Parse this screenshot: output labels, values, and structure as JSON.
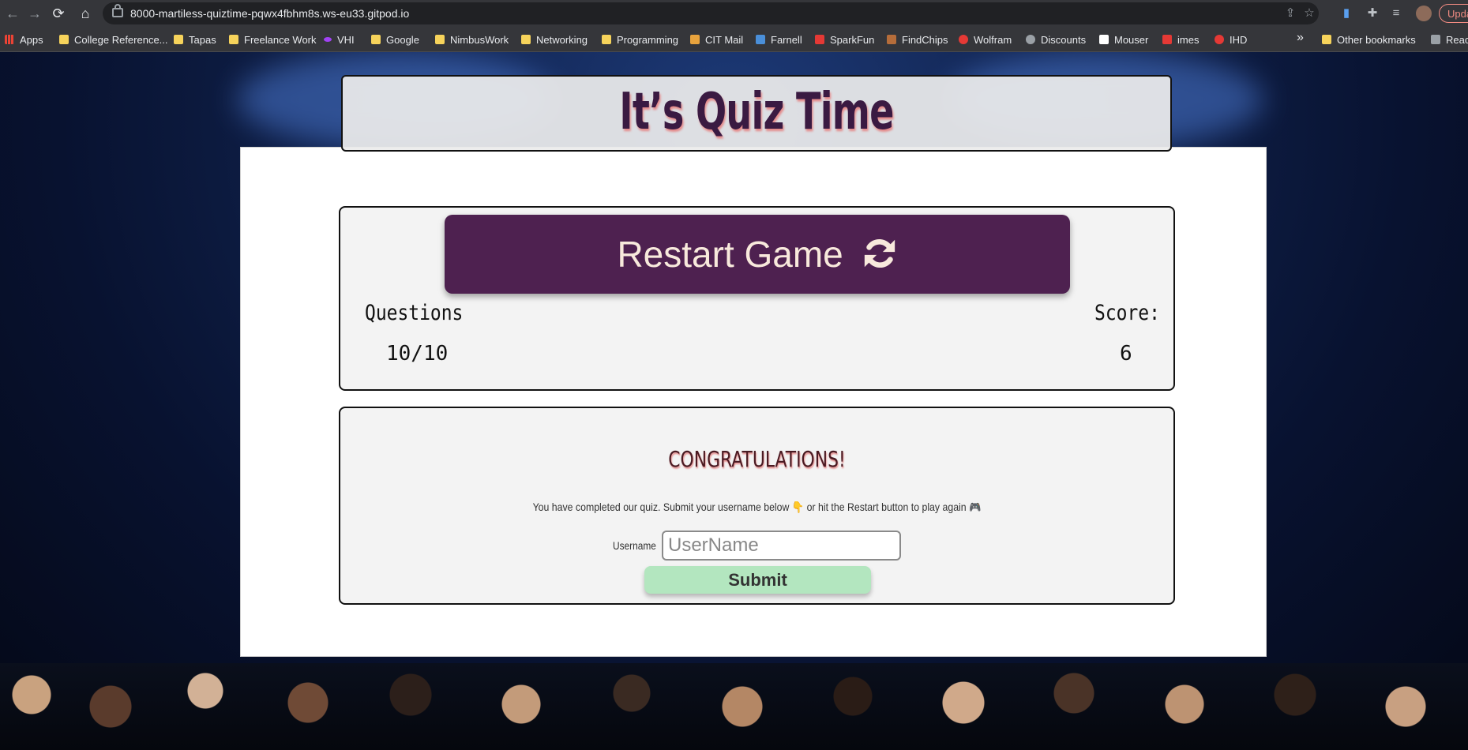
{
  "browser": {
    "url": "8000-martiless-quiztime-pqwx4fbhm8s.ws-eu33.gitpod.io",
    "update_label": "Update"
  },
  "bookmarks": [
    {
      "label": "Apps",
      "icon": "apps-grid-icon"
    },
    {
      "label": "College Reference...",
      "icon": "folder-icon"
    },
    {
      "label": "Tapas",
      "icon": "folder-icon"
    },
    {
      "label": "Freelance Work",
      "icon": "folder-icon"
    },
    {
      "label": "VHI",
      "icon": "vhi-logo-icon"
    },
    {
      "label": "Google",
      "icon": "folder-icon"
    },
    {
      "label": "NimbusWork",
      "icon": "folder-icon"
    },
    {
      "label": "Networking",
      "icon": "folder-icon"
    },
    {
      "label": "Programming",
      "icon": "folder-icon"
    },
    {
      "label": "CIT Mail",
      "icon": "mail-icon"
    },
    {
      "label": "Farnell",
      "icon": "farnell-icon"
    },
    {
      "label": "SparkFun",
      "icon": "sparkfun-icon"
    },
    {
      "label": "FindChips",
      "icon": "findchips-icon"
    },
    {
      "label": "Wolfram",
      "icon": "wolfram-icon"
    },
    {
      "label": "Discounts",
      "icon": "globe-icon"
    },
    {
      "label": "Mouser",
      "icon": "mouser-icon"
    },
    {
      "label": "imes",
      "icon": "imes-icon"
    },
    {
      "label": "IHD",
      "icon": "ihd-icon"
    }
  ],
  "bookmarks_more": "»",
  "other_bookmarks": "Other bookmarks",
  "reading_list": "Reac",
  "quiz": {
    "title": "It’s Quiz Time",
    "restart_label": "Restart Game",
    "questions_label": "Questions",
    "questions_value": "10/10",
    "score_label": "Score:",
    "score_value": "6",
    "congrats": "CONGRATULATIONS!",
    "message": "You have completed our quiz. Submit your username below 👇 or hit the Restart button to play again 🎮",
    "username_label": "Username",
    "username_placeholder": "UserName",
    "username_value": "",
    "submit_label": "Submit"
  },
  "colors": {
    "title_text": "#3a1a42",
    "restart_button": "#4e2150",
    "restart_text": "#f8e9dc",
    "submit_button": "#b3e6bf",
    "panel_bg": "#f3f3f3"
  }
}
